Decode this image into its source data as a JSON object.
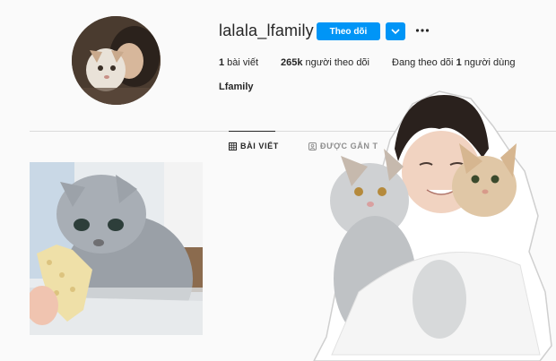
{
  "profile": {
    "username": "lalala_lfamily",
    "follow_label": "Theo dõi",
    "full_name": "Lfamily"
  },
  "stats": {
    "posts_count": "1",
    "posts_label": " bài viết",
    "followers_count": "265k",
    "followers_label": " người theo dõi",
    "following_prefix": "Đang theo dõi ",
    "following_count": "1",
    "following_suffix": " người dùng"
  },
  "tabs": [
    {
      "label": "BÀI VIẾT",
      "icon": "grid-icon",
      "active": true
    },
    {
      "label": "ĐƯỢC GẮN T",
      "icon": "tagged-icon",
      "active": false
    }
  ],
  "colors": {
    "accent": "#0095f6",
    "text": "#262626",
    "background": "#fafafa",
    "divider": "#dbdbdb"
  }
}
